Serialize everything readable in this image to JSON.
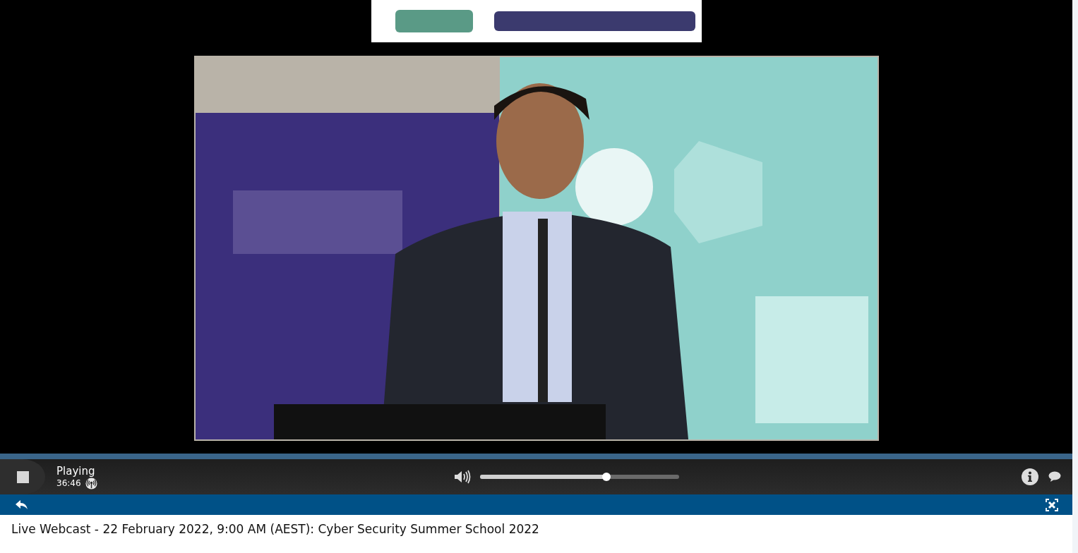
{
  "player": {
    "status": "Playing",
    "time": "36:46",
    "live": true,
    "volume": {
      "level": 0.635
    }
  },
  "title": "Live Webcast - 22 February 2022, 9:00 AM (AEST): Cyber Security Summer School 2022"
}
